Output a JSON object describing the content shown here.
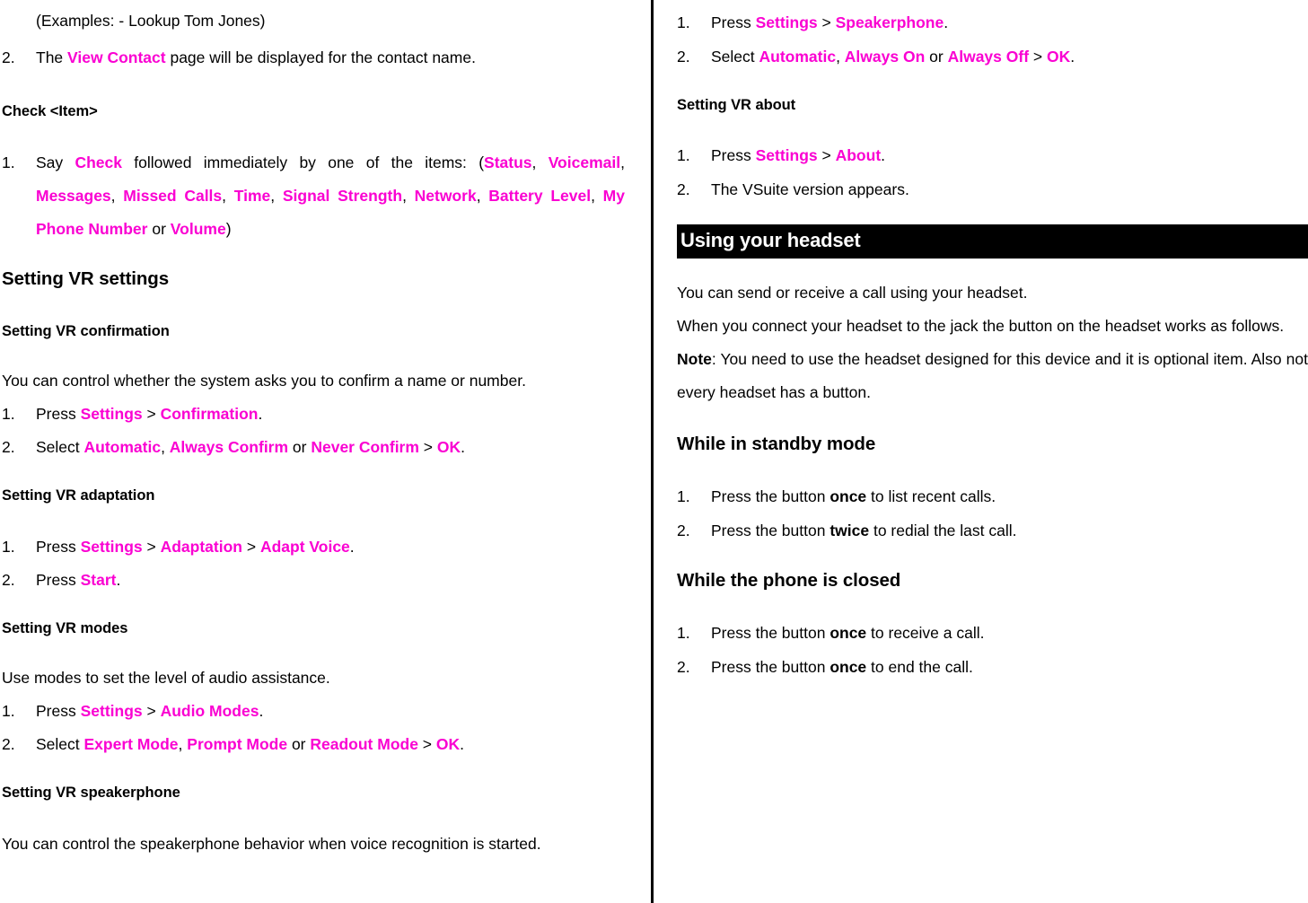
{
  "colors": {
    "highlight": "#FA00D2",
    "banner_bg": "#000000",
    "banner_fg": "#FFFFFF",
    "text": "#000000"
  },
  "left_column": {
    "example_line": "(Examples: - Lookup Tom Jones)",
    "step_view_contact": {
      "num": "2.",
      "pre": "The ",
      "term": "View Contact",
      "post": " page will be displayed for the contact name."
    },
    "heading_check_item": "Check <Item>",
    "step_say_check": {
      "num": "1.",
      "t1": "Say ",
      "k1": "Check",
      "t2": " followed immediately by one of the items: (",
      "items": [
        "Status",
        "Voicemail",
        "Messages",
        "Missed Calls",
        "Time",
        "Signal Strength",
        "Network",
        "Battery Level",
        "My Phone Number",
        "Volume"
      ],
      "or_word": " or ",
      "close": ")"
    },
    "heading_vr_settings": "Setting VR settings",
    "sub_confirmation": "Setting VR confirmation",
    "confirmation_intro": "You can control whether the system asks you to confirm a name or number.",
    "confirmation_steps": [
      {
        "num": "1.",
        "t1": "Press ",
        "k1": "Settings",
        "t2": " > ",
        "k2": "Confirmation",
        "t3": "."
      },
      {
        "num": "2.",
        "t1": "Select ",
        "k1": "Automatic",
        "t2": ", ",
        "k2": "Always Confirm",
        "t3": " or ",
        "k3": "Never Confirm",
        "t4": " > ",
        "k4": "OK",
        "t5": "."
      }
    ],
    "sub_adaptation": "Setting VR adaptation",
    "adaptation_steps": [
      {
        "num": "1.",
        "t1": "Press ",
        "k1": "Settings",
        "t2": " > ",
        "k2": "Adaptation",
        "t3": " > ",
        "k3": "Adapt Voice",
        "t4": "."
      },
      {
        "num": "2.",
        "t1": "Press ",
        "k1": "Start",
        "t2": "."
      }
    ],
    "sub_modes": "Setting VR modes",
    "modes_intro": "Use modes to set the level of audio assistance.",
    "modes_steps": [
      {
        "num": "1.",
        "t1": "Press ",
        "k1": "Settings",
        "t2": " > ",
        "k2": "Audio Modes",
        "t3": "."
      },
      {
        "num": "2.",
        "t1": "Select ",
        "k1": "Expert Mode",
        "t2": ", ",
        "k2": "Prompt Mode",
        "t3": " or ",
        "k3": "Readout Mode",
        "t4": " > ",
        "k4": "OK",
        "t5": "."
      }
    ],
    "sub_speakerphone": "Setting VR speakerphone",
    "speakerphone_intro": "You can control the speakerphone behavior when voice recognition is started."
  },
  "right_column": {
    "speakerphone_steps": [
      {
        "num": "1.",
        "t1": "Press ",
        "k1": "Settings",
        "t2": " > ",
        "k2": "Speakerphone",
        "t3": "."
      },
      {
        "num": "2.",
        "t1": "Select ",
        "k1": "Automatic",
        "t2": ", ",
        "k2": "Always On",
        "t3": " or ",
        "k3": "Always Off",
        "t4": " > ",
        "k4": "OK",
        "t5": "."
      }
    ],
    "sub_about": "Setting VR about",
    "about_steps": [
      {
        "num": "1.",
        "t1": "Press ",
        "k1": "Settings",
        "t2": " > ",
        "k2": "About",
        "t3": "."
      },
      {
        "num": "2.",
        "t1": "The VSuite version appears.",
        "k1": "",
        "t2": ""
      }
    ],
    "banner_title": "Using your headset",
    "headset_para_1": "You can send or receive a call using your headset.",
    "headset_para_2": "When you connect your headset to the jack the button on the headset works as follows.",
    "headset_note": {
      "label": "Note",
      "text": ": You need to use the headset designed for this device and it is optional item. Also not every headset has a button."
    },
    "heading_standby": "While in standby mode",
    "standby_steps": [
      {
        "num": "1.",
        "t1": "Press the button ",
        "b1": "once",
        "t2": " to list recent calls."
      },
      {
        "num": "2.",
        "t1": "Press the button ",
        "b1": "twice",
        "t2": " to redial the last call."
      }
    ],
    "heading_closed": "While the phone is closed",
    "closed_steps": [
      {
        "num": "1.",
        "t1": "Press the button ",
        "b1": "once",
        "t2": " to receive a call."
      },
      {
        "num": "2.",
        "t1": "Press the button ",
        "b1": "once",
        "t2": " to end the call."
      }
    ]
  }
}
